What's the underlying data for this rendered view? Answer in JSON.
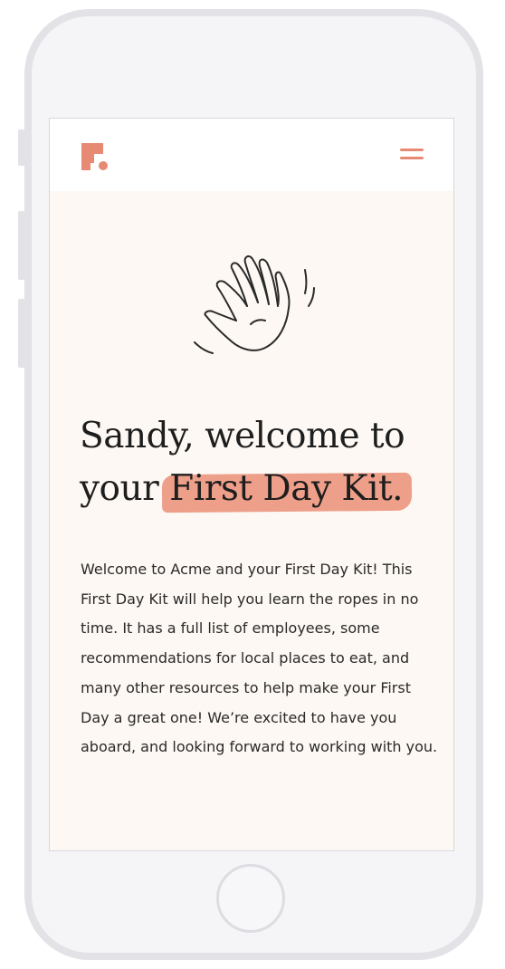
{
  "header": {
    "logo_icon": "brand-logo-icon",
    "menu_icon": "hamburger-menu-icon",
    "accent_color": "#e68a73"
  },
  "hero": {
    "illustration_icon": "waving-hand-icon",
    "headline_line1": "Sandy, welcome to",
    "headline_line2_prefix": "your ",
    "headline_highlight": "First Day Kit."
  },
  "intro": {
    "text": "Welcome to Acme and your First Day Kit! This First Day Kit will help you learn the ropes in no time. It has a full list of employees, some recommendations for local places to eat, and many other resources to help make your First Day a great one! We’re excited to have you aboard, and looking forward to working with you."
  },
  "device": {
    "home_button_icon": "home-button-icon"
  }
}
